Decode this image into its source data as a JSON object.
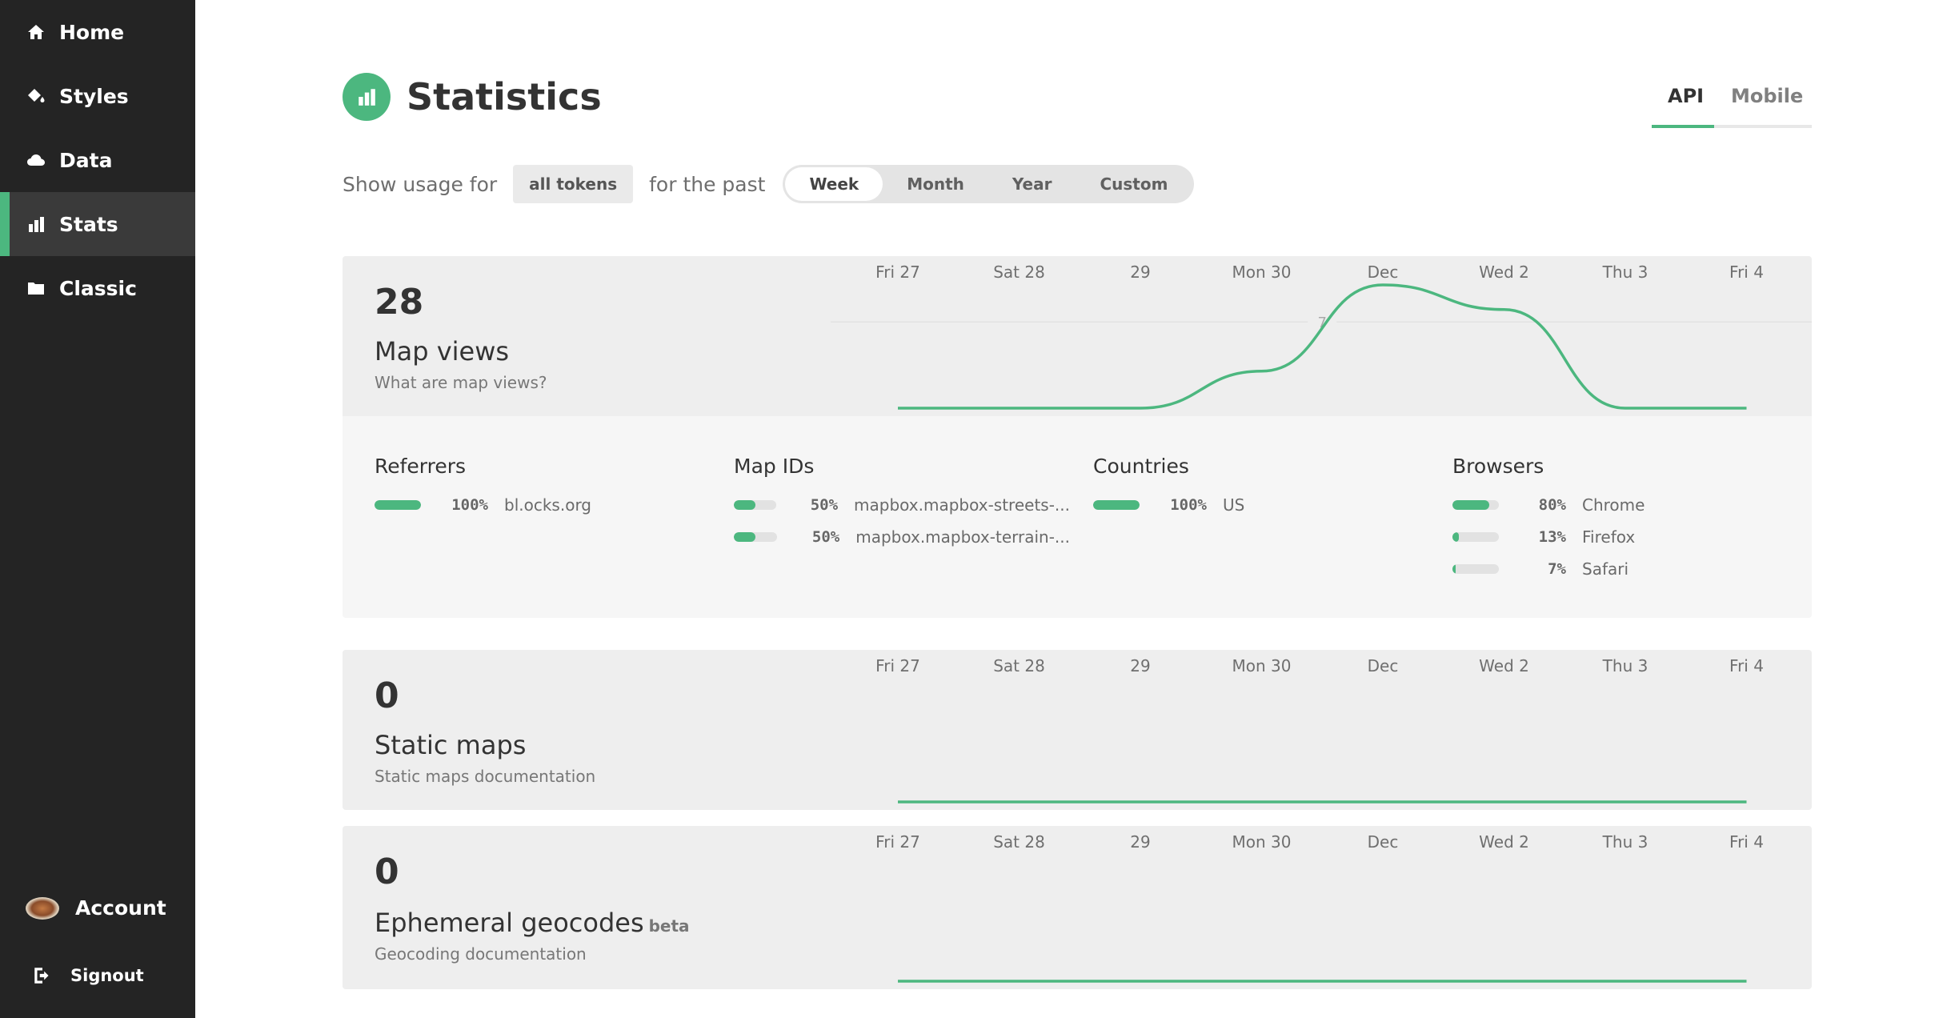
{
  "sidebar": {
    "items": [
      {
        "label": "Home",
        "icon": "home-icon",
        "active": false
      },
      {
        "label": "Styles",
        "icon": "paint-bucket-icon",
        "active": false
      },
      {
        "label": "Data",
        "icon": "cloud-icon",
        "active": false
      },
      {
        "label": "Stats",
        "icon": "bar-chart-icon",
        "active": true
      },
      {
        "label": "Classic",
        "icon": "folder-icon",
        "active": false
      }
    ],
    "account": {
      "label": "Account"
    },
    "signout": {
      "label": "Signout"
    }
  },
  "header": {
    "title": "Statistics",
    "tabs": [
      {
        "label": "API",
        "active": true
      },
      {
        "label": "Mobile",
        "active": false
      }
    ]
  },
  "usage": {
    "prefix": "Show usage for",
    "token_filter": "all tokens",
    "middle": "for the past",
    "periods": [
      {
        "label": "Week",
        "active": true
      },
      {
        "label": "Month",
        "active": false
      },
      {
        "label": "Year",
        "active": false
      },
      {
        "label": "Custom",
        "active": false
      }
    ]
  },
  "colors": {
    "accent": "#4cb77f",
    "sidebar": "#242424",
    "card": "#eeeeee"
  },
  "cards": [
    {
      "total": "28",
      "title": "Map views",
      "beta": "",
      "link": "What are map views?"
    },
    {
      "total": "0",
      "title": "Static maps",
      "beta": "",
      "link": "Static maps documentation"
    },
    {
      "total": "0",
      "title": "Ephemeral geocodes",
      "beta": "beta",
      "link": "Geocoding documentation"
    }
  ],
  "chart_data": [
    {
      "type": "line",
      "categories": [
        "Fri 27",
        "Sat 28",
        "29",
        "Mon 30",
        "Dec",
        "Wed 2",
        "Thu 3",
        "Fri 4"
      ],
      "series": [
        {
          "values": [
            0,
            0,
            0,
            3,
            10,
            8,
            0,
            0
          ]
        }
      ],
      "gridline_label": "7",
      "ylim": [
        0,
        10
      ],
      "grid": true
    },
    {
      "type": "line",
      "categories": [
        "Fri 27",
        "Sat 28",
        "29",
        "Mon 30",
        "Dec",
        "Wed 2",
        "Thu 3",
        "Fri 4"
      ],
      "series": [
        {
          "values": [
            0,
            0,
            0,
            0,
            0,
            0,
            0,
            0
          ]
        }
      ],
      "ylim": [
        0,
        10
      ]
    },
    {
      "type": "line",
      "categories": [
        "Fri 27",
        "Sat 28",
        "29",
        "Mon 30",
        "Dec",
        "Wed 2",
        "Thu 3",
        "Fri 4"
      ],
      "series": [
        {
          "values": [
            0,
            0,
            0,
            0,
            0,
            0,
            0,
            0
          ]
        }
      ],
      "ylim": [
        0,
        10
      ]
    }
  ],
  "breakdown": [
    {
      "title": "Referrers",
      "rows": [
        {
          "pct": 100,
          "pct_label": "100%",
          "label": "bl.ocks.org"
        }
      ]
    },
    {
      "title": "Map IDs",
      "rows": [
        {
          "pct": 50,
          "pct_label": "50%",
          "label": "mapbox.mapbox-streets-..."
        },
        {
          "pct": 50,
          "pct_label": "50%",
          "label": "mapbox.mapbox-terrain-..."
        }
      ]
    },
    {
      "title": "Countries",
      "rows": [
        {
          "pct": 100,
          "pct_label": "100%",
          "label": "US"
        }
      ]
    },
    {
      "title": "Browsers",
      "rows": [
        {
          "pct": 80,
          "pct_label": "80%",
          "label": "Chrome"
        },
        {
          "pct": 13,
          "pct_label": "13%",
          "label": "Firefox"
        },
        {
          "pct": 7,
          "pct_label": "7%",
          "label": "Safari"
        }
      ]
    }
  ]
}
